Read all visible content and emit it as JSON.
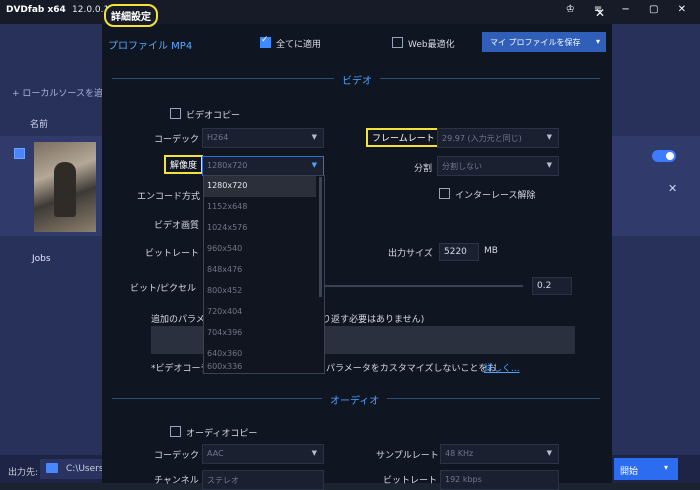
{
  "app": {
    "logo_text": "DVDfab x64",
    "version": "12.0.0.1",
    "add_source": "+ ローカルソースを追加",
    "col_name": "名前",
    "jobs": "Jobs",
    "output_label": "出力先:",
    "output_path": "C:\\Users",
    "start_button": "開始",
    "win_icons": "♔ ≡ − ▢ ✕",
    "close_row": "✕"
  },
  "dialog": {
    "title": "詳細設定",
    "close": "✕",
    "profile": "プロファイル MP4",
    "apply_all_label": "全てに適用",
    "apply_all_checked": true,
    "web_opt_label": "Web最適化",
    "web_opt_checked": false,
    "save_profile": "マイ プロファイルを保存",
    "save_arrow": "▾"
  },
  "video": {
    "section_title": "ビデオ",
    "video_copy_label": "ビデオコピー",
    "codec_label": "コーデック",
    "codec_value": "H264",
    "framerate_label": "フレームレート",
    "framerate_value": "29.97 (入力元と同じ)",
    "resolution_label": "解像度",
    "resolution_value": "1280x720",
    "split_label": "分割",
    "split_value": "分割しない",
    "encode_label": "エンコード方式",
    "deinterlace_label": "インターレース解除",
    "quality_label": "ビデオ画質",
    "bitrate_label": "ビットレート",
    "output_size_label": "出力サイズ",
    "output_size_value": "5220",
    "output_size_unit": "MB",
    "bpp_label": "ビット/ピクセル",
    "bpp_value": "0.2",
    "extra_params_label": "追加のパラメ",
    "extra_params_tail": "り返す必要はありません)",
    "note_prefix": "*ビデオコーデ",
    "note_mid": "パラメータをカスタマイズしないことをお",
    "note_link": "詳しく..."
  },
  "resolution_options": [
    "1280x720",
    "1152x648",
    "1024x576",
    "960x540",
    "848x476",
    "800x452",
    "720x404",
    "704x396",
    "640x360",
    "600x336"
  ],
  "audio": {
    "section_title": "オーディオ",
    "audio_copy_label": "オーディオコピー",
    "codec_label": "コーデック",
    "codec_value": "AAC",
    "samplerate_label": "サンプルレート",
    "samplerate_value": "48 KHz",
    "channel_label": "チャンネル",
    "channel_value": "ステレオ",
    "bitrate_label": "ビットレート",
    "bitrate_value": "192 kbps"
  }
}
